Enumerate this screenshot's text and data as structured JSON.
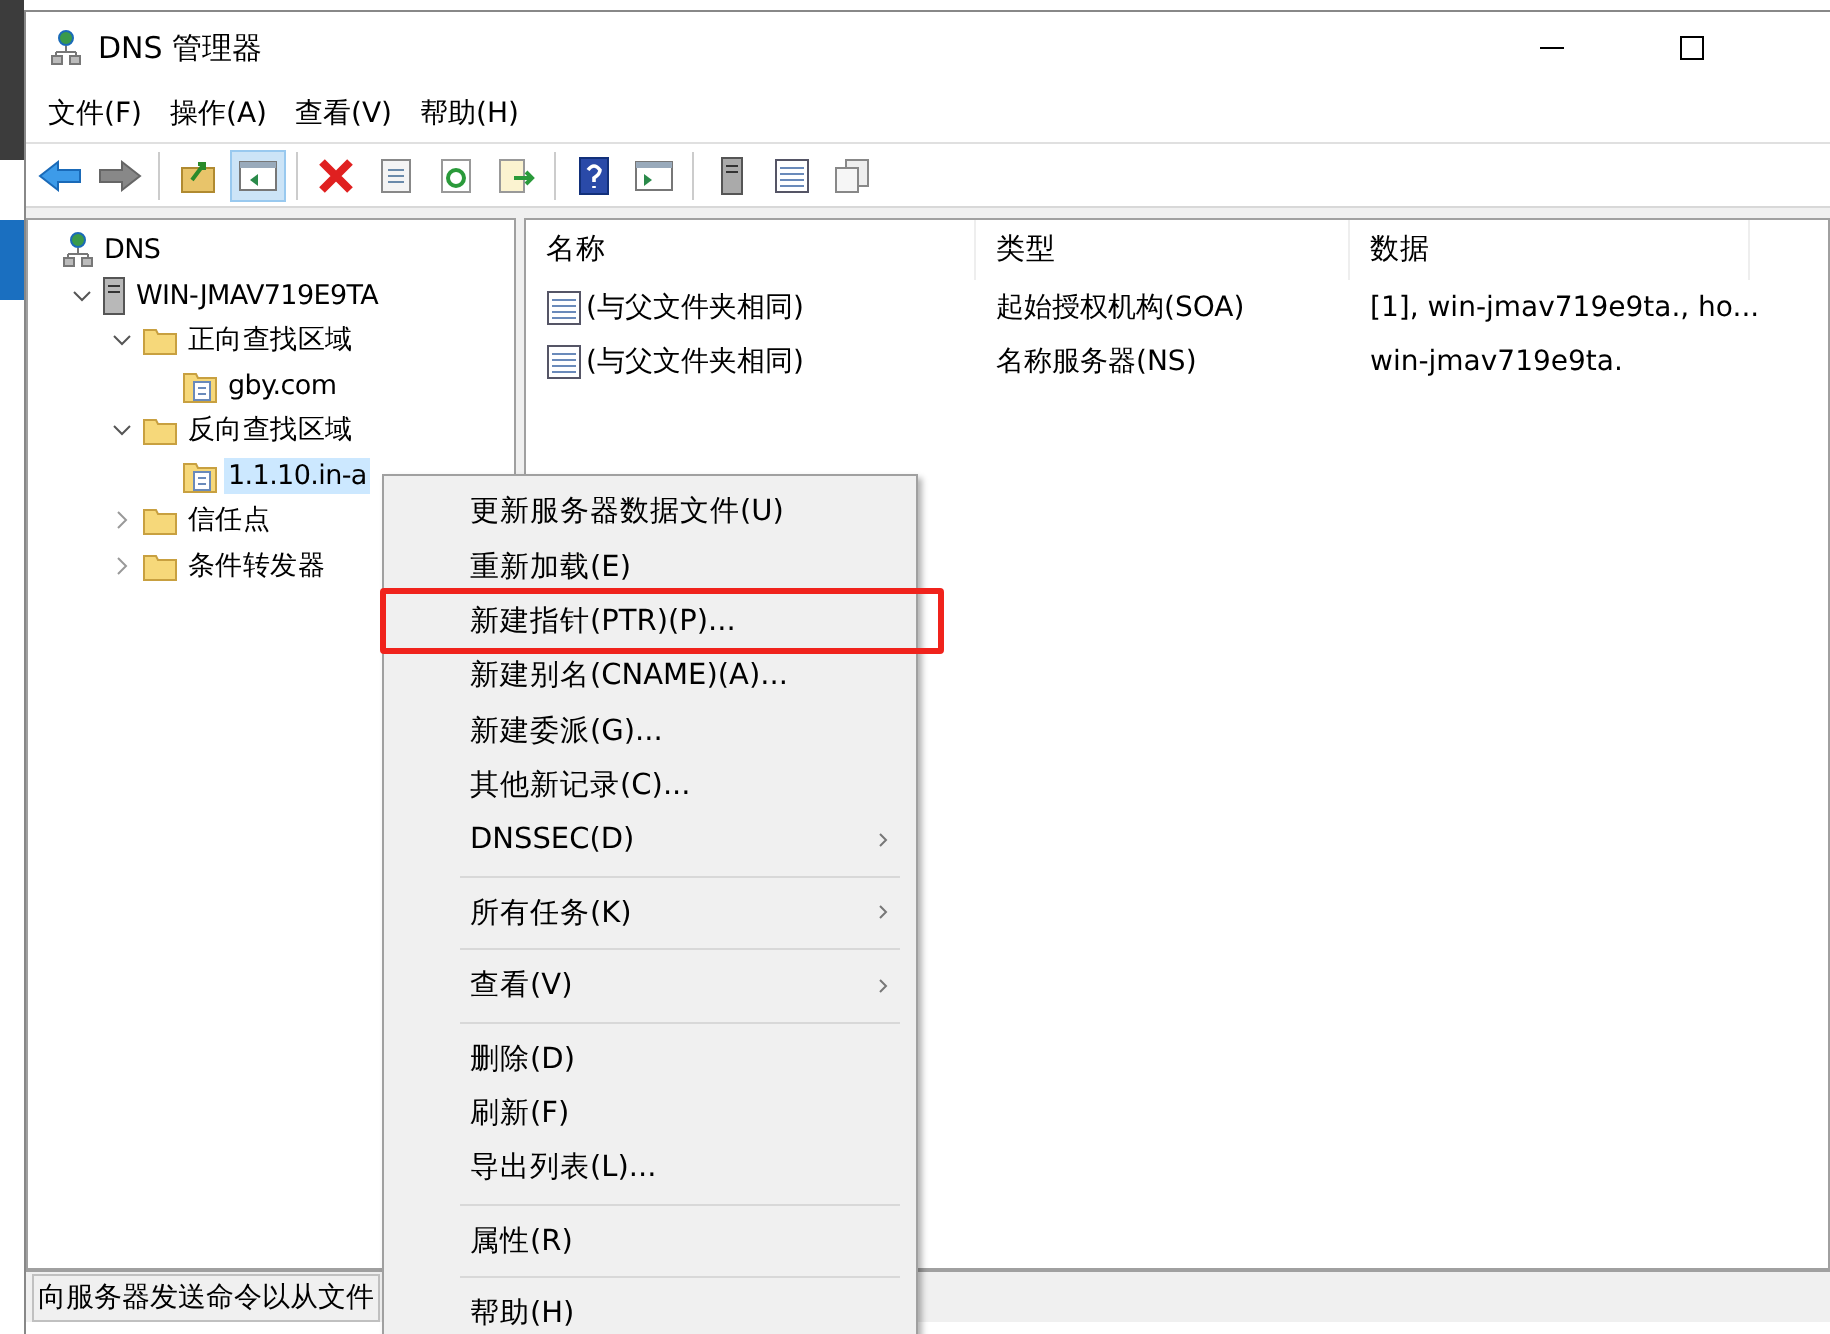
{
  "window": {
    "title": "DNS 管理器"
  },
  "menu_bar": [
    "文件(F)",
    "操作(A)",
    "查看(V)",
    "帮助(H)"
  ],
  "toolbar": [
    {
      "kind": "back"
    },
    {
      "kind": "forward"
    },
    {
      "kind": "sep"
    },
    {
      "kind": "up"
    },
    {
      "kind": "tree",
      "selected": true
    },
    {
      "kind": "sep"
    },
    {
      "kind": "delete"
    },
    {
      "kind": "properties"
    },
    {
      "kind": "refresh"
    },
    {
      "kind": "export"
    },
    {
      "kind": "sep"
    },
    {
      "kind": "help"
    },
    {
      "kind": "pane"
    },
    {
      "kind": "sep"
    },
    {
      "kind": "server"
    },
    {
      "kind": "list"
    },
    {
      "kind": "copy"
    }
  ],
  "tree": [
    {
      "label": "DNS",
      "kind": "dns",
      "selected": false,
      "children": [
        {
          "label": "WIN-JMAV719E9TA",
          "kind": "server",
          "expanded": true,
          "selected": false,
          "children": [
            {
              "label": "正向查找区域",
              "kind": "folder",
              "expanded": true,
              "selected": false,
              "children": [
                {
                  "label": "gby.com",
                  "kind": "zone",
                  "selected": false
                }
              ]
            },
            {
              "label": "反向查找区域",
              "kind": "folder",
              "expanded": true,
              "selected": false,
              "children": [
                {
                  "label": "1.1.10.in-a",
                  "kind": "zone",
                  "selected": true
                }
              ]
            },
            {
              "label": "信任点",
              "kind": "folder",
              "expanded": false,
              "selected": false
            },
            {
              "label": "条件转发器",
              "kind": "folder",
              "expanded": false,
              "selected": false
            }
          ]
        }
      ]
    }
  ],
  "list": {
    "columns": [
      "名称",
      "类型",
      "数据"
    ],
    "rows": [
      [
        "(与父文件夹相同)",
        "起始授权机构(SOA)",
        "[1], win-jmav719e9ta., ho..."
      ],
      [
        "(与父文件夹相同)",
        "名称服务器(NS)",
        "win-jmav719e9ta."
      ]
    ]
  },
  "context_menu": [
    {
      "kind": "item",
      "label": "更新服务器数据文件(U)",
      "submenu": false,
      "highlighted": false
    },
    {
      "kind": "item",
      "label": "重新加载(E)",
      "submenu": false,
      "highlighted": false
    },
    {
      "kind": "item",
      "label": "新建指针(PTR)(P)...",
      "submenu": false,
      "highlighted": true
    },
    {
      "kind": "item",
      "label": "新建别名(CNAME)(A)...",
      "submenu": false,
      "highlighted": false
    },
    {
      "kind": "item",
      "label": "新建委派(G)...",
      "submenu": false,
      "highlighted": false
    },
    {
      "kind": "item",
      "label": "其他新记录(C)...",
      "submenu": false,
      "highlighted": false
    },
    {
      "kind": "item",
      "label": "DNSSEC(D)",
      "submenu": true,
      "highlighted": false
    },
    {
      "kind": "separator"
    },
    {
      "kind": "item",
      "label": "所有任务(K)",
      "submenu": true,
      "highlighted": false
    },
    {
      "kind": "separator"
    },
    {
      "kind": "item",
      "label": "查看(V)",
      "submenu": true,
      "highlighted": false
    },
    {
      "kind": "separator"
    },
    {
      "kind": "item",
      "label": "删除(D)",
      "submenu": false,
      "highlighted": false
    },
    {
      "kind": "item",
      "label": "刷新(F)",
      "submenu": false,
      "highlighted": false
    },
    {
      "kind": "item",
      "label": "导出列表(L)...",
      "submenu": false,
      "highlighted": false
    },
    {
      "kind": "separator"
    },
    {
      "kind": "item",
      "label": "属性(R)",
      "submenu": false,
      "highlighted": false
    },
    {
      "kind": "separator"
    },
    {
      "kind": "item",
      "label": "帮助(H)",
      "submenu": false,
      "highlighted": false
    }
  ],
  "status_bar": "向服务器发送命令以从文件"
}
